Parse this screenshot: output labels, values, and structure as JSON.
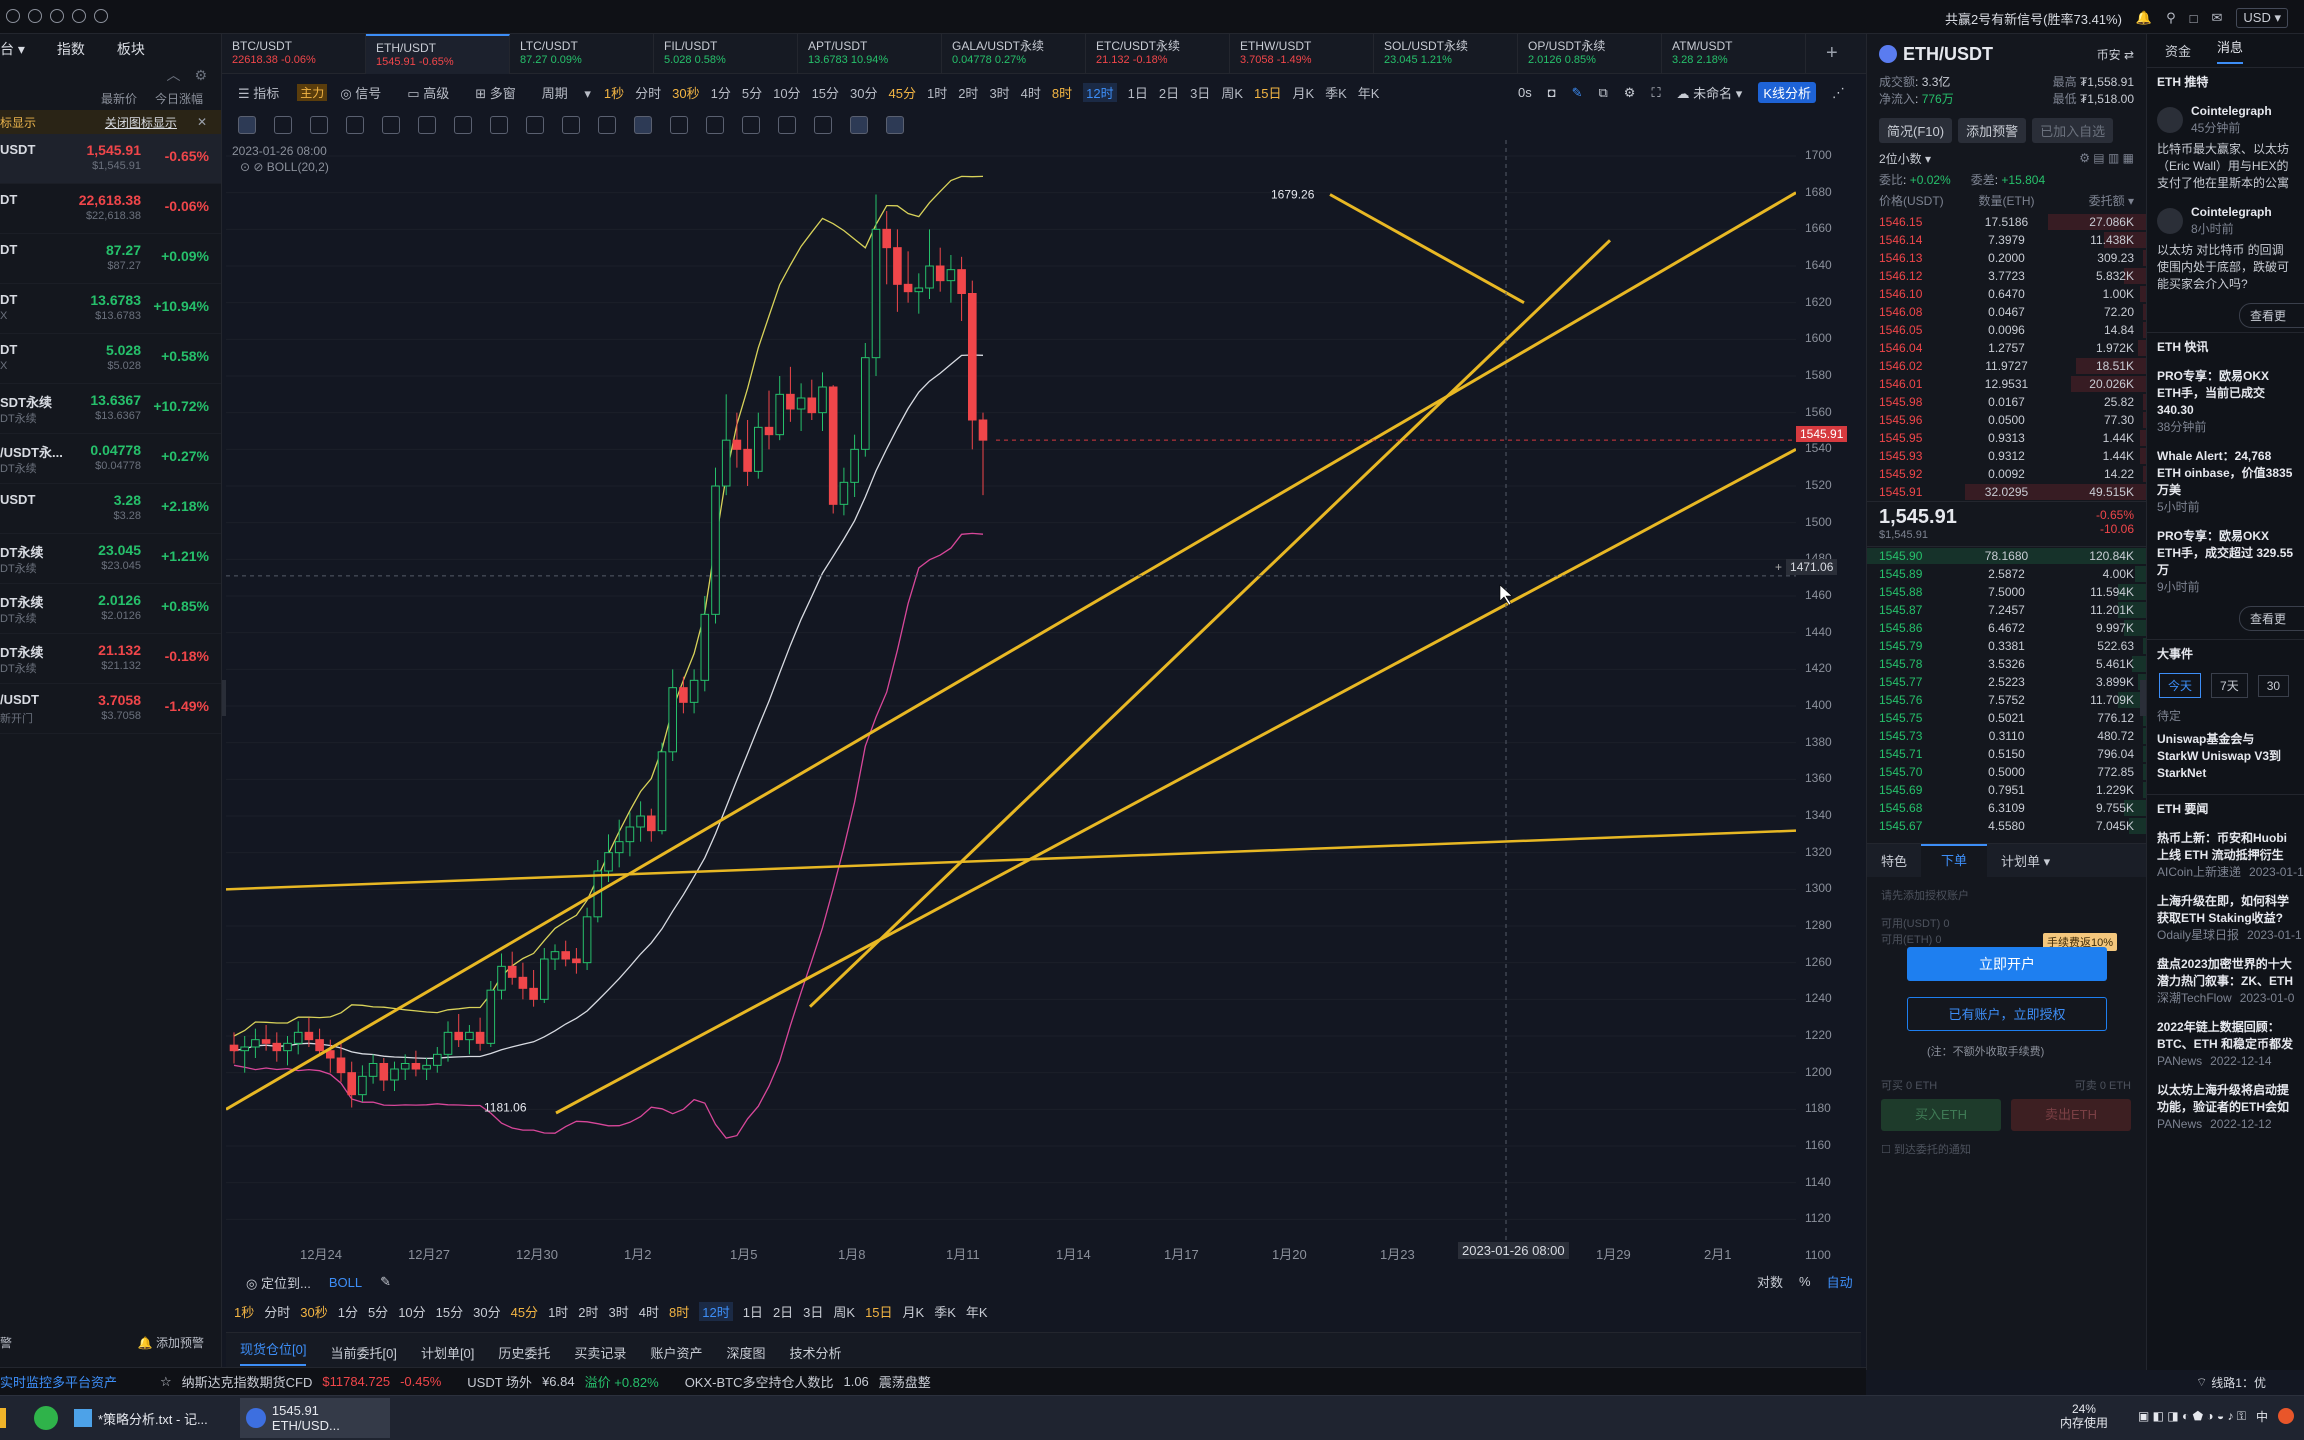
{
  "topbar": {
    "signal_text": "共赢2号有新信号(胜率73.41%)",
    "currency": "USD"
  },
  "tabs": [
    {
      "sym": "BTC/USDT",
      "price": "22618.38",
      "chg": "-0.06%",
      "dir": "dn"
    },
    {
      "sym": "ETH/USDT",
      "price": "1545.91",
      "chg": "-0.65%",
      "dir": "dn"
    },
    {
      "sym": "LTC/USDT",
      "price": "87.27",
      "chg": "0.09%",
      "dir": "up"
    },
    {
      "sym": "FIL/USDT",
      "price": "5.028",
      "chg": "0.58%",
      "dir": "up"
    },
    {
      "sym": "APT/USDT",
      "price": "13.6783",
      "chg": "10.94%",
      "dir": "up"
    },
    {
      "sym": "GALA/USDT永续",
      "price": "0.04778",
      "chg": "0.27%",
      "dir": "up"
    },
    {
      "sym": "ETC/USDT永续",
      "price": "21.132",
      "chg": "-0.18%",
      "dir": "dn"
    },
    {
      "sym": "ETHW/USDT",
      "price": "3.7058",
      "chg": "-1.49%",
      "dir": "dn"
    },
    {
      "sym": "SOL/USDT永续",
      "price": "23.045",
      "chg": "1.21%",
      "dir": "up"
    },
    {
      "sym": "OP/USDT永续",
      "price": "2.0126",
      "chg": "0.85%",
      "dir": "up"
    },
    {
      "sym": "ATM/USDT",
      "price": "3.28",
      "chg": "2.18%",
      "dir": "up"
    }
  ],
  "left": {
    "nav": [
      "台",
      "指数",
      "板块"
    ],
    "sort1": "最新价",
    "sort2": "今日涨幅",
    "banner_left": "标显示",
    "banner_right": "关闭图标显示",
    "rows": [
      {
        "sym": "USDT",
        "sub": "",
        "price": "1,545.91",
        "sub_price": "$1,545.91",
        "chg": "-0.65%",
        "dir": "dn"
      },
      {
        "sym": "DT",
        "sub": "",
        "price": "22,618.38",
        "sub_price": "$22,618.38",
        "chg": "-0.06%",
        "dir": "dn"
      },
      {
        "sym": "DT",
        "sub": "",
        "price": "87.27",
        "sub_price": "$87.27",
        "chg": "+0.09%",
        "dir": "up"
      },
      {
        "sym": "DT",
        "sub": "X",
        "price": "13.6783",
        "sub_price": "$13.6783",
        "chg": "+10.94%",
        "dir": "up"
      },
      {
        "sym": "DT",
        "sub": "X",
        "price": "5.028",
        "sub_price": "$5.028",
        "chg": "+0.58%",
        "dir": "up"
      },
      {
        "sym": "SDT永续",
        "sub": "DT永续",
        "price": "13.6367",
        "sub_price": "$13.6367",
        "chg": "+10.72%",
        "dir": "up"
      },
      {
        "sym": "/USDT永...",
        "sub": "DT永续",
        "price": "0.04778",
        "sub_price": "$0.04778",
        "chg": "+0.27%",
        "dir": "up"
      },
      {
        "sym": "USDT",
        "sub": "",
        "price": "3.28",
        "sub_price": "$3.28",
        "chg": "+2.18%",
        "dir": "up"
      },
      {
        "sym": "DT永续",
        "sub": "DT永续",
        "price": "23.045",
        "sub_price": "$23.045",
        "chg": "+1.21%",
        "dir": "up"
      },
      {
        "sym": "DT永续",
        "sub": "DT永续",
        "price": "2.0126",
        "sub_price": "$2.0126",
        "chg": "+0.85%",
        "dir": "up"
      },
      {
        "sym": "DT永续",
        "sub": "DT永续",
        "price": "21.132",
        "sub_price": "$21.132",
        "chg": "-0.18%",
        "dir": "dn"
      },
      {
        "sym": "/USDT",
        "sub": "新开门",
        "price": "3.7058",
        "sub_price": "$3.7058",
        "chg": "-1.49%",
        "dir": "dn"
      }
    ],
    "footer": "添加预警",
    "footer_left": "警"
  },
  "chart_toolbar": {
    "items": [
      "指标",
      "主力",
      "信号",
      "高级",
      "多窗",
      "周期"
    ],
    "periods": [
      "1秒",
      "分时",
      "30秒",
      "1分",
      "5分",
      "10分",
      "15分",
      "30分",
      "45分",
      "1时",
      "2时",
      "3时",
      "4时",
      "8时",
      "12时",
      "1日",
      "2日",
      "3日",
      "周K",
      "15日",
      "月K",
      "季K",
      "年K"
    ],
    "active_period": "12时",
    "right": [
      "0s",
      "未命名",
      "K线分析"
    ]
  },
  "chart_labels": {
    "datetime": "2023-01-26 08:00",
    "indicator": "BOLL(20,2)",
    "high_label": "1679.26",
    "low_label": "1181.06",
    "price_tag": "1545.91",
    "cross_tag": "1471.06",
    "x_cursor": "2023-01-26 08:00"
  },
  "chart_data": {
    "type": "candlestick",
    "ylim": [
      1100,
      1700
    ],
    "y_ticks": [
      1700,
      1680,
      1660,
      1640,
      1620,
      1600,
      1580,
      1560,
      1540,
      1520,
      1500,
      1480,
      1460,
      1440,
      1420,
      1400,
      1380,
      1360,
      1340,
      1320,
      1300,
      1280,
      1260,
      1240,
      1220,
      1200,
      1180,
      1160,
      1140,
      1120,
      1100
    ],
    "x_ticks": [
      "12月24",
      "12月27",
      "12月30",
      "1月2",
      "1月5",
      "1月8",
      "1月11",
      "1月14",
      "1月17",
      "1月20",
      "1月23",
      "1月29",
      "2月1"
    ],
    "candles": [
      [
        1215,
        1222,
        1205,
        1212
      ],
      [
        1212,
        1220,
        1200,
        1214
      ],
      [
        1214,
        1224,
        1208,
        1218
      ],
      [
        1218,
        1226,
        1212,
        1216
      ],
      [
        1216,
        1222,
        1206,
        1212
      ],
      [
        1212,
        1220,
        1204,
        1216
      ],
      [
        1216,
        1228,
        1210,
        1222
      ],
      [
        1222,
        1230,
        1214,
        1218
      ],
      [
        1218,
        1224,
        1210,
        1212
      ],
      [
        1212,
        1218,
        1200,
        1208
      ],
      [
        1208,
        1216,
        1195,
        1200
      ],
      [
        1200,
        1206,
        1181,
        1188
      ],
      [
        1188,
        1204,
        1184,
        1198
      ],
      [
        1198,
        1210,
        1194,
        1205
      ],
      [
        1205,
        1208,
        1190,
        1196
      ],
      [
        1196,
        1206,
        1190,
        1202
      ],
      [
        1202,
        1210,
        1196,
        1205
      ],
      [
        1205,
        1212,
        1198,
        1202
      ],
      [
        1202,
        1208,
        1196,
        1204
      ],
      [
        1204,
        1214,
        1200,
        1210
      ],
      [
        1210,
        1228,
        1206,
        1222
      ],
      [
        1222,
        1232,
        1214,
        1218
      ],
      [
        1218,
        1226,
        1210,
        1222
      ],
      [
        1222,
        1230,
        1212,
        1216
      ],
      [
        1216,
        1250,
        1214,
        1245
      ],
      [
        1245,
        1265,
        1240,
        1258
      ],
      [
        1258,
        1266,
        1248,
        1252
      ],
      [
        1252,
        1260,
        1240,
        1246
      ],
      [
        1246,
        1256,
        1236,
        1240
      ],
      [
        1240,
        1268,
        1238,
        1262
      ],
      [
        1262,
        1270,
        1256,
        1266
      ],
      [
        1266,
        1272,
        1258,
        1262
      ],
      [
        1262,
        1268,
        1254,
        1260
      ],
      [
        1260,
        1290,
        1256,
        1285
      ],
      [
        1285,
        1316,
        1282,
        1310
      ],
      [
        1310,
        1330,
        1304,
        1320
      ],
      [
        1320,
        1338,
        1312,
        1326
      ],
      [
        1326,
        1342,
        1318,
        1334
      ],
      [
        1334,
        1348,
        1326,
        1340
      ],
      [
        1340,
        1344,
        1326,
        1332
      ],
      [
        1332,
        1380,
        1330,
        1375
      ],
      [
        1375,
        1420,
        1370,
        1410
      ],
      [
        1410,
        1416,
        1396,
        1402
      ],
      [
        1402,
        1420,
        1396,
        1414
      ],
      [
        1414,
        1460,
        1408,
        1450
      ],
      [
        1450,
        1530,
        1445,
        1520
      ],
      [
        1520,
        1570,
        1515,
        1545
      ],
      [
        1545,
        1560,
        1530,
        1540
      ],
      [
        1540,
        1556,
        1520,
        1528
      ],
      [
        1528,
        1560,
        1524,
        1552
      ],
      [
        1552,
        1572,
        1540,
        1548
      ],
      [
        1548,
        1580,
        1545,
        1570
      ],
      [
        1570,
        1585,
        1555,
        1562
      ],
      [
        1562,
        1576,
        1550,
        1568
      ],
      [
        1568,
        1578,
        1556,
        1560
      ],
      [
        1560,
        1582,
        1550,
        1574
      ],
      [
        1574,
        1575,
        1505,
        1510
      ],
      [
        1510,
        1530,
        1504,
        1522
      ],
      [
        1522,
        1548,
        1514,
        1540
      ],
      [
        1540,
        1598,
        1536,
        1590
      ],
      [
        1590,
        1679,
        1580,
        1660
      ],
      [
        1660,
        1670,
        1630,
        1650
      ],
      [
        1650,
        1660,
        1615,
        1630
      ],
      [
        1630,
        1648,
        1620,
        1626
      ],
      [
        1626,
        1636,
        1614,
        1628
      ],
      [
        1628,
        1660,
        1622,
        1640
      ],
      [
        1640,
        1650,
        1626,
        1632
      ],
      [
        1632,
        1646,
        1620,
        1638
      ],
      [
        1638,
        1645,
        1610,
        1625
      ],
      [
        1625,
        1632,
        1540,
        1556
      ],
      [
        1556,
        1560,
        1515,
        1545
      ]
    ]
  },
  "chart_bottom": {
    "locate": "定位到...",
    "indicator": "BOLL",
    "right": [
      "对数",
      "%",
      "自动"
    ]
  },
  "bottom_tabs": [
    "现货仓位[0]",
    "当前委托[0]",
    "计划单[0]",
    "历史委托",
    "买卖记录",
    "账户资产",
    "深度图",
    "技术分析"
  ],
  "ticker": [
    {
      "label": "纳斯达克指数期货CFD",
      "value": "$11784.725",
      "chg": "-0.45%"
    },
    {
      "label": "USDT 场外",
      "value": "¥6.84",
      "chg": "溢价 +0.82%"
    },
    {
      "label": "OKX-BTC多空持仓人数比",
      "value": "1.06",
      "chg": "震荡盘整"
    }
  ],
  "ticker_left": "实时监控多平台资产",
  "orderbook": {
    "pair": "ETH/USDT",
    "exchange": "币安",
    "vol_label": "成交额",
    "vol": "3.3亿",
    "net_label": "净流入",
    "net": "776万",
    "high_label": "最高",
    "high": "₮1,558.91",
    "low_label": "最低",
    "low": "₮1,518.00",
    "btn1": "简况(F10)",
    "btn2": "添加预警",
    "btn3": "已加入自选",
    "decimals": "2位小数",
    "ratio_label": "委比",
    "ratio": "+0.02%",
    "diff_label": "委差",
    "diff": "+15.804",
    "cols": [
      "价格(USDT)",
      "数量(ETH)",
      "委托额"
    ],
    "asks": [
      [
        "1546.15",
        "17.5186",
        "27.086K"
      ],
      [
        "1546.14",
        "7.3979",
        "11.438K"
      ],
      [
        "1546.13",
        "0.2000",
        "309.23"
      ],
      [
        "1546.12",
        "3.7723",
        "5.832K"
      ],
      [
        "1546.10",
        "0.6470",
        "1.00K"
      ],
      [
        "1546.08",
        "0.0467",
        "72.20"
      ],
      [
        "1546.05",
        "0.0096",
        "14.84"
      ],
      [
        "1546.04",
        "1.2757",
        "1.972K"
      ],
      [
        "1546.02",
        "11.9727",
        "18.51K"
      ],
      [
        "1546.01",
        "12.9531",
        "20.026K"
      ],
      [
        "1545.98",
        "0.0167",
        "25.82"
      ],
      [
        "1545.96",
        "0.0500",
        "77.30"
      ],
      [
        "1545.95",
        "0.9313",
        "1.44K"
      ],
      [
        "1545.93",
        "0.9312",
        "1.44K"
      ],
      [
        "1545.92",
        "0.0092",
        "14.22"
      ],
      [
        "1545.91",
        "32.0295",
        "49.515K"
      ]
    ],
    "ask_depth": [
      0.35,
      0.15,
      0.01,
      0.08,
      0.02,
      0.01,
      0.01,
      0.03,
      0.25,
      0.27,
      0.01,
      0.01,
      0.02,
      0.02,
      0.01,
      0.65
    ],
    "last": "1,545.91",
    "last_usd": "$1,545.91",
    "last_chg": "-0.65%",
    "last_diff": "-10.06",
    "bids": [
      [
        "1545.90",
        "78.1680",
        "120.84K"
      ],
      [
        "1545.89",
        "2.5872",
        "4.00K"
      ],
      [
        "1545.88",
        "7.5000",
        "11.594K"
      ],
      [
        "1545.87",
        "7.2457",
        "11.201K"
      ],
      [
        "1545.86",
        "6.4672",
        "9.997K"
      ],
      [
        "1545.79",
        "0.3381",
        "522.63"
      ],
      [
        "1545.78",
        "3.5326",
        "5.461K"
      ],
      [
        "1545.77",
        "2.5223",
        "3.899K"
      ],
      [
        "1545.76",
        "7.5752",
        "11.709K"
      ],
      [
        "1545.75",
        "0.5021",
        "776.12"
      ],
      [
        "1545.73",
        "0.3110",
        "480.72"
      ],
      [
        "1545.71",
        "0.5150",
        "796.04"
      ],
      [
        "1545.70",
        "0.5000",
        "772.85"
      ],
      [
        "1545.69",
        "0.7951",
        "1.229K"
      ],
      [
        "1545.68",
        "6.3109",
        "9.755K"
      ],
      [
        "1545.67",
        "4.5580",
        "7.045K"
      ]
    ],
    "bid_depth": [
      1.0,
      0.04,
      0.1,
      0.1,
      0.08,
      0.01,
      0.05,
      0.03,
      0.1,
      0.01,
      0.01,
      0.01,
      0.01,
      0.01,
      0.08,
      0.06
    ],
    "trade_tabs": [
      "特色",
      "下单",
      "计划单"
    ],
    "trade_hint": "请先添加授权账户",
    "avail_usdt": "可用(USDT) 0",
    "avail_eth": "可用(ETH) 0",
    "fee_badge": "手续费返10%",
    "open_btn": "立即开户",
    "auth_btn": "已有账户，立即授权",
    "fee_note": "(注：不额外收取手续费)",
    "can_buy": "可买 0 ETH",
    "can_sell": "可卖 0 ETH",
    "buy_btn": "买入ETH",
    "sell_btn": "卖出ETH",
    "notify": "到达委托的通知"
  },
  "news": {
    "tabs": [
      "资金",
      "消息"
    ],
    "section1": "ETH 推特",
    "tweets": [
      {
        "author": "Cointelegraph",
        "time": "45分钟前",
        "text": "比特币最大赢家、以太坊（Eric Wall）用与HEX的支付了他在里斯本的公寓"
      },
      {
        "author": "Cointelegraph",
        "time": "8小时前",
        "text": "以太坊 对比特币 的回调使围内处于底部，跌破可能买家会介入吗?"
      }
    ],
    "more": "查看更",
    "section2": "ETH 快讯",
    "flash": [
      {
        "text": "PRO专享：欧易OKX ETH手，当前已成交 340.30",
        "time": "38分钟前"
      },
      {
        "text": "Whale Alert：24,768 ETH oinbase，价值3835万美",
        "time": "5小时前"
      },
      {
        "text": "PRO专享：欧易OKX ETH手，成交超过 329.55 万",
        "time": "9小时前"
      }
    ],
    "section3": "大事件",
    "ev_tabs": [
      "今天",
      "7天",
      "30"
    ],
    "ev_status": "待定",
    "ev_text": "Uniswap基金会与StarkW Uniswap V3到StarkNet",
    "section4": "ETH 要闻",
    "headlines": [
      {
        "title": "热币上新：币安和Huobi上线 ETH 流动抵押衍生",
        "src": "AICoin上新速递",
        "date": "2023-01-1"
      },
      {
        "title": "上海升级在即，如何科学获取ETH Staking收益?",
        "src": "Odaily星球日报",
        "date": "2023-01-1"
      },
      {
        "title": "盘点2023加密世界的十大潜力热门叙事：ZK、ETH",
        "src": "深潮TechFlow",
        "date": "2023-01-0"
      },
      {
        "title": "2022年链上数据回顾：BTC、ETH 和稳定币都发",
        "src": "PANews",
        "date": "2022-12-14"
      },
      {
        "title": "以太坊上海升级将启动提功能，验证者的ETH会如",
        "src": "PANews",
        "date": "2022-12-12"
      }
    ]
  },
  "taskbar": {
    "items": [
      "*策略分析.txt - 记...",
      "1545.91 ETH/USD..."
    ],
    "mem_pct": "24%",
    "mem_label": "内存使用",
    "clock_lang": "中",
    "line": "线路1：优"
  }
}
